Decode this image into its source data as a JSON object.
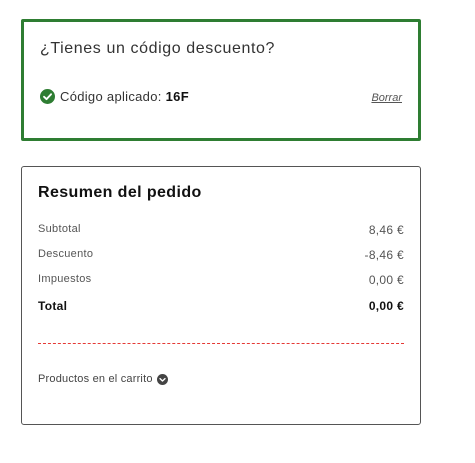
{
  "discount": {
    "title": "¿Tienes un código descuento?",
    "applied_label": "Código aplicado:",
    "applied_code": "16F",
    "clear_label": "Borrar",
    "accent_color": "#2e7d32",
    "icon": "check-circle-icon"
  },
  "summary": {
    "title": "Resumen del pedido",
    "rows": [
      {
        "label": "Subtotal",
        "value": "8,46 €"
      },
      {
        "label": "Descuento",
        "value": "-8,46 €"
      },
      {
        "label": "Impuestos",
        "value": "0,00 €"
      }
    ],
    "total": {
      "label": "Total",
      "value": "0,00 €"
    },
    "divider_color": "#e53935",
    "products_label": "Productos en el carrito",
    "products_icon": "chevron-down-circle-icon"
  }
}
